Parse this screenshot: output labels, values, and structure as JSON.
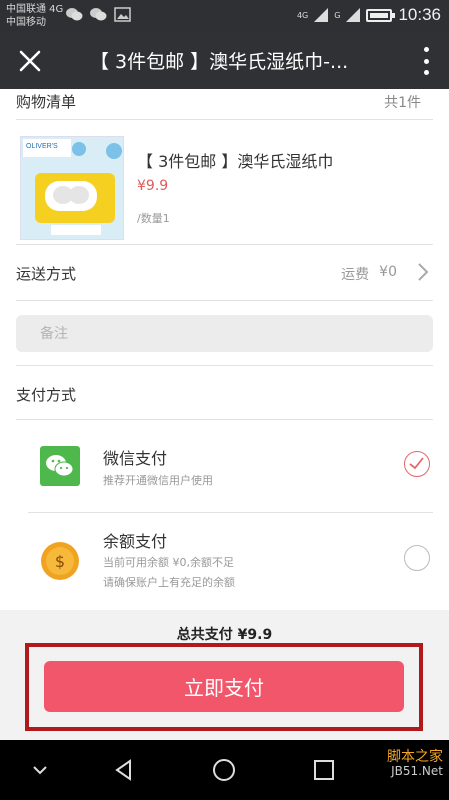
{
  "status_bar": {
    "carrier_1": "中国联通 4G",
    "carrier_2": "中国移动",
    "network_1": "4G",
    "network_2": "G",
    "time": "10:36"
  },
  "title_bar": {
    "title": "【 3件包邮 】澳华氏湿纸巾-..."
  },
  "cart": {
    "heading": "购物清单",
    "count": "共1件",
    "product": {
      "title": "【 3件包邮 】澳华氏湿纸巾",
      "price": "¥9.9",
      "quantity": "/数量1"
    }
  },
  "shipping": {
    "label": "运送方式",
    "fee_label": "运费",
    "fee_value": "¥0"
  },
  "note": {
    "placeholder": "备注"
  },
  "payment": {
    "heading": "支付方式",
    "options": [
      {
        "name": "微信支付",
        "desc_1": "推荐开通微信用户使用",
        "selected": true,
        "icon": "wechat-icon",
        "color": "#4fb84d"
      },
      {
        "name": "余额支付",
        "desc_1": "当前可用余额 ¥0,余额不足",
        "desc_2": "请确保账户上有充足的余额",
        "selected": false,
        "icon": "coin-icon",
        "color": "#f0a321"
      }
    ]
  },
  "footer": {
    "total": "总共支付 ¥9.9",
    "pay_button": "立即支付"
  },
  "watermark": {
    "line_1": "脚本之家",
    "line_2": "JB51.Net"
  },
  "colors": {
    "accent": "#f1566b",
    "price": "#e25a5a",
    "highlight": "#b01a1a"
  }
}
